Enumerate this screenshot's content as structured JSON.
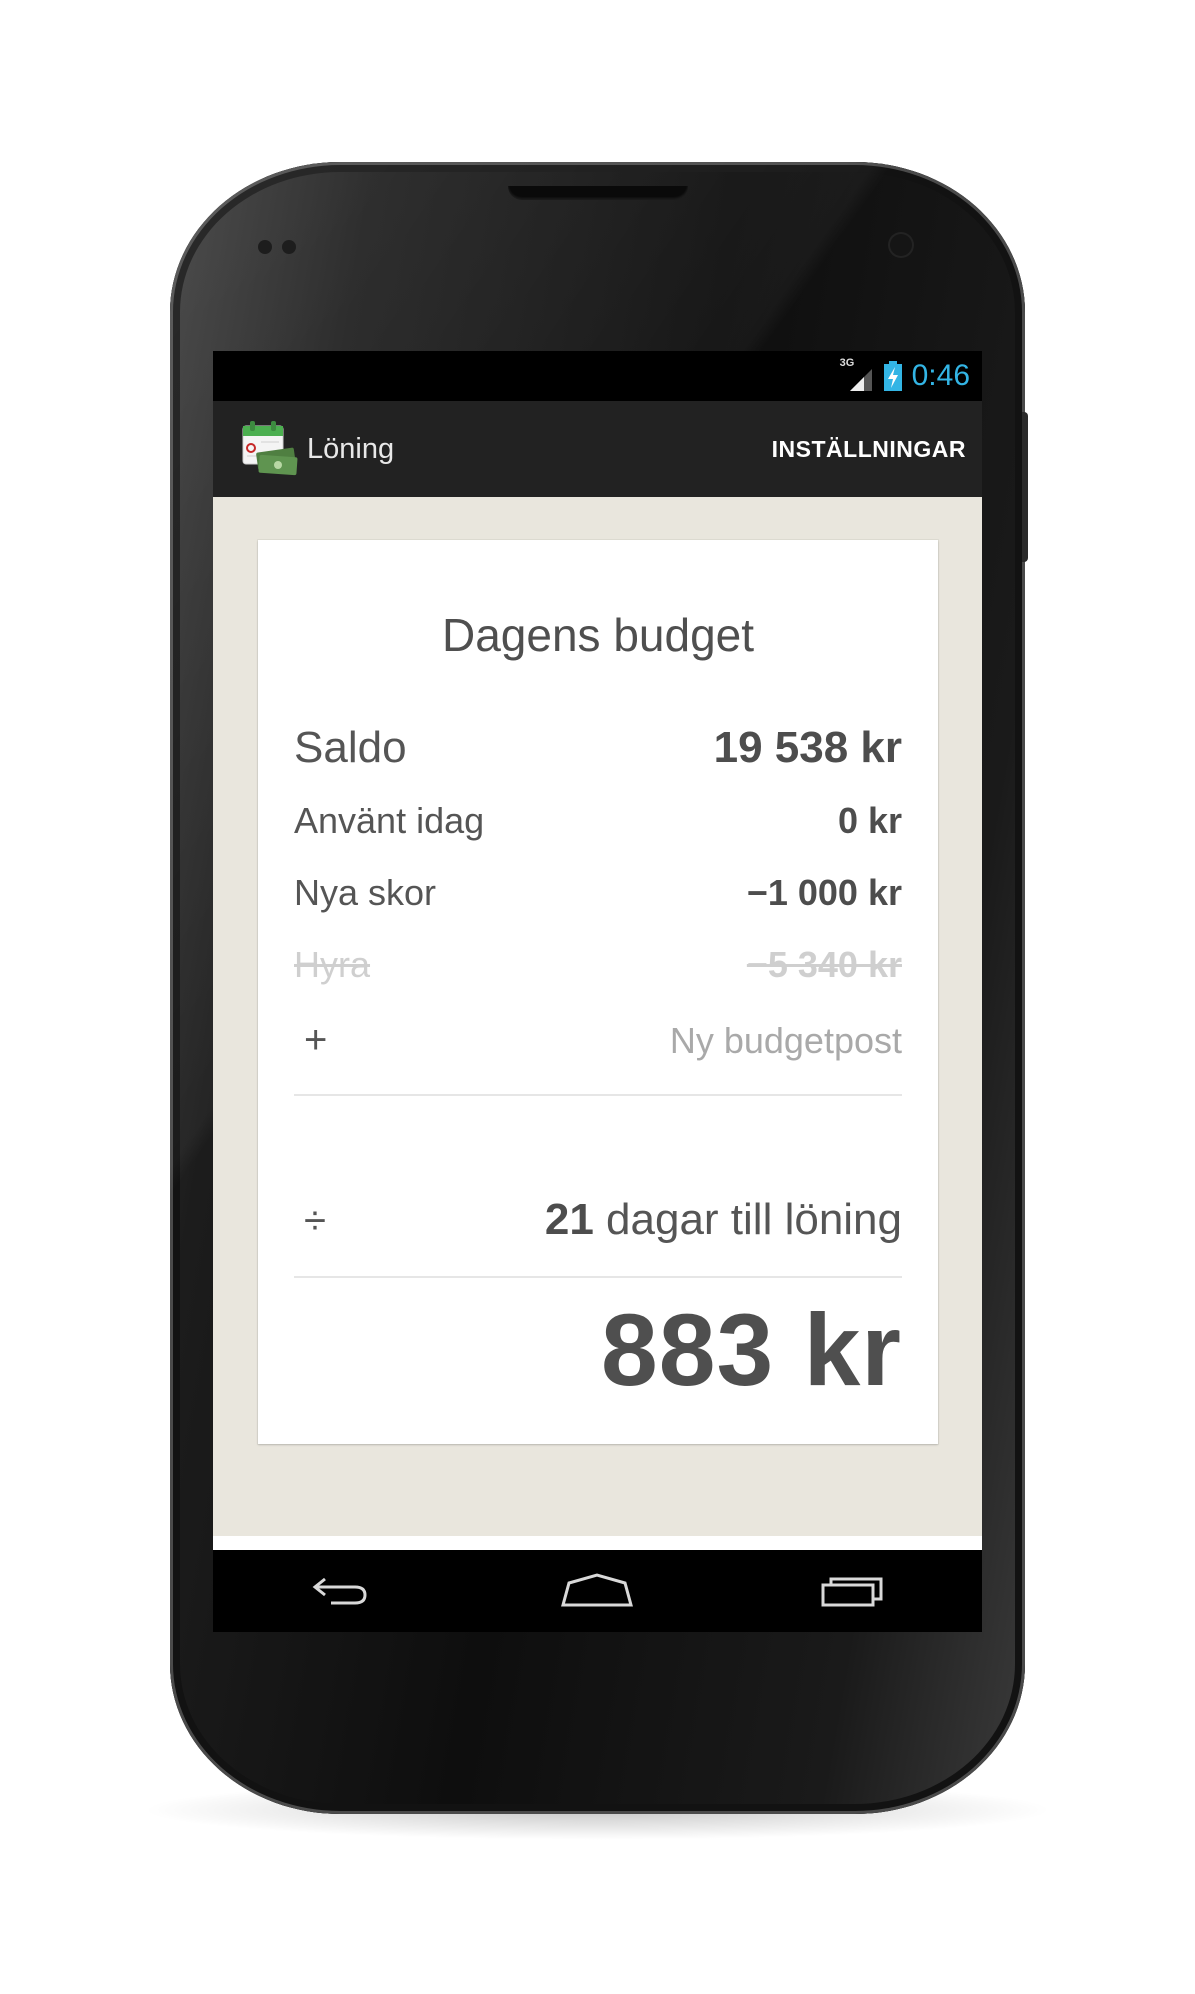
{
  "status_bar": {
    "network_type": "3G",
    "time": "0:46"
  },
  "action_bar": {
    "app_title": "Löning",
    "settings_label": "INSTÄLLNINGAR"
  },
  "budget_card": {
    "title": "Dagens budget",
    "balance": {
      "label": "Saldo",
      "amount": "19 538 kr"
    },
    "items": [
      {
        "label": "Använt idag",
        "amount": "0 kr",
        "struck": false
      },
      {
        "label": "Nya skor",
        "amount": "−1 000 kr",
        "struck": false
      },
      {
        "label": "Hyra",
        "amount": "−5 340 kr",
        "struck": true
      }
    ],
    "new_item": {
      "icon": "plus-icon",
      "symbol": "+",
      "label": "Ny budgetpost"
    },
    "days": {
      "icon": "divide-icon",
      "symbol": "÷",
      "count": "21",
      "label": "dagar till löning"
    },
    "daily_budget": "883 kr"
  },
  "nav_bar": {
    "buttons": [
      "back-icon",
      "home-icon",
      "recent-apps-icon"
    ]
  },
  "colors": {
    "clock_accent": "#33b5e5",
    "content_background": "#e9e6dd",
    "action_bar": "#222222"
  }
}
